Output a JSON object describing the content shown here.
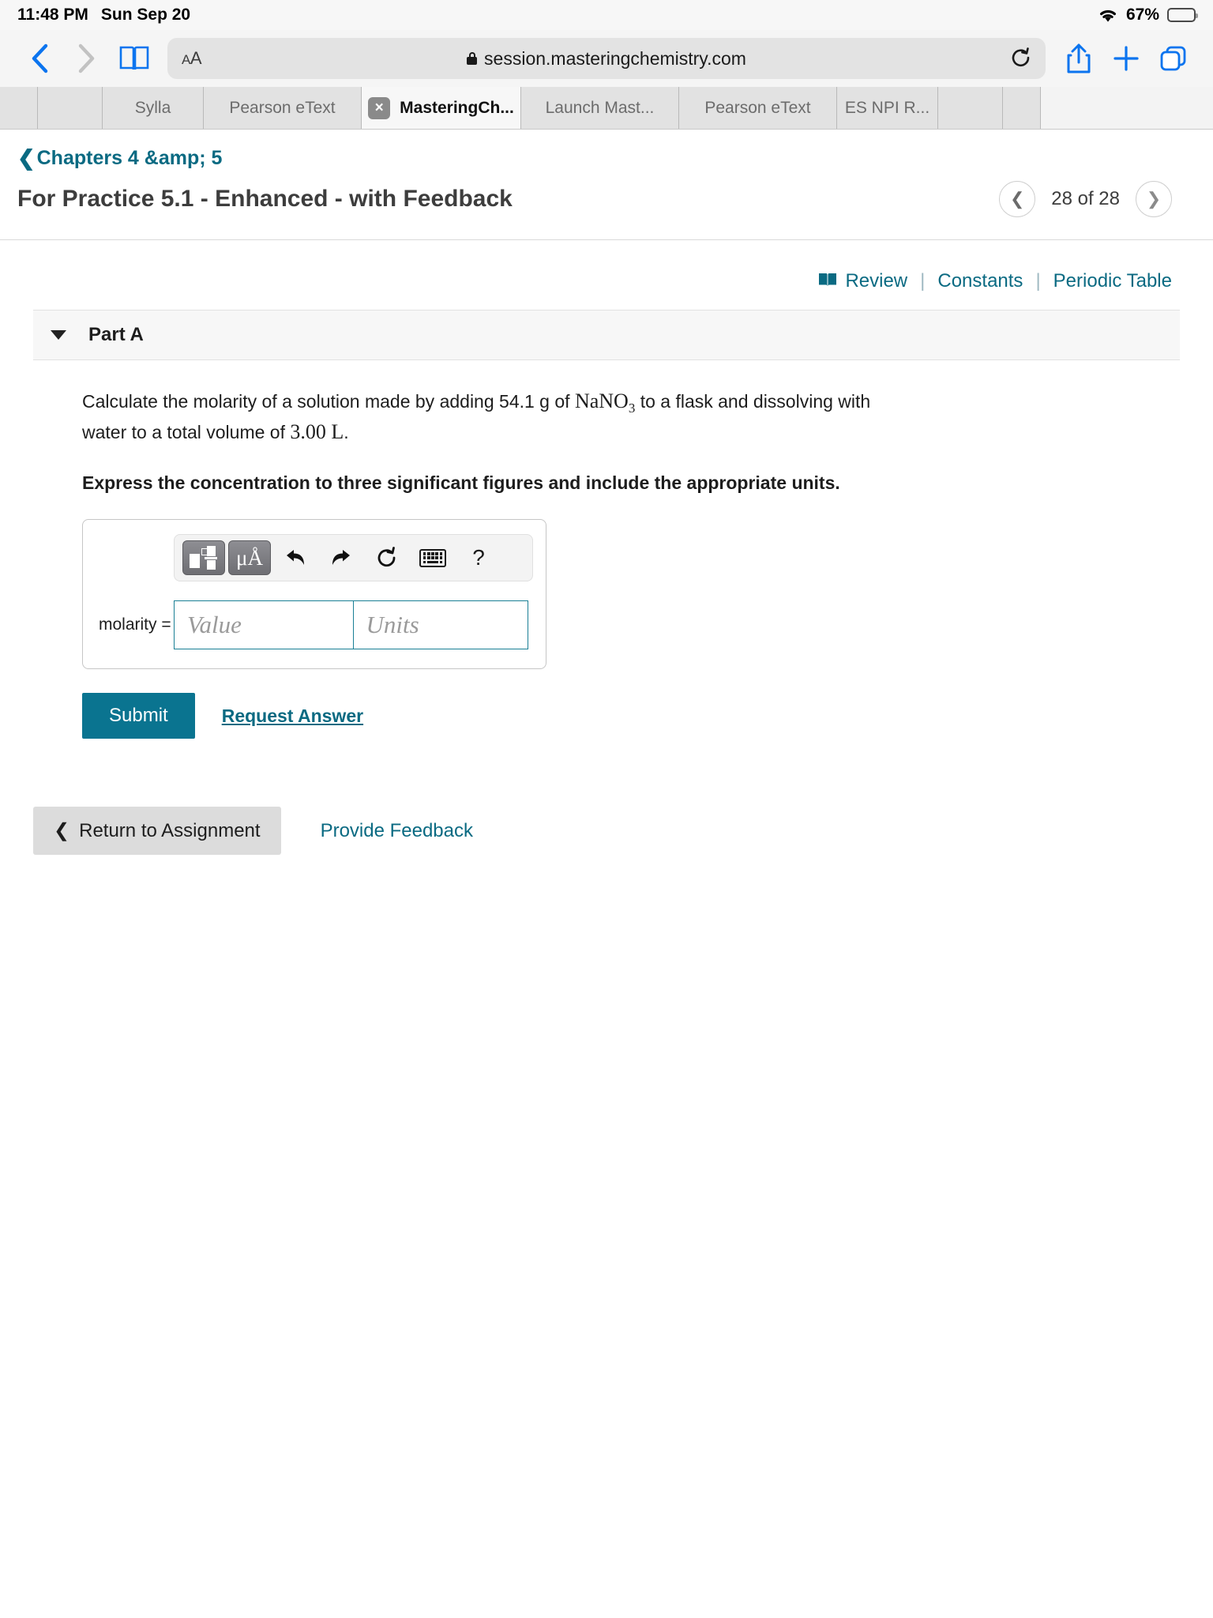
{
  "statusbar": {
    "time": "11:48 PM",
    "date": "Sun Sep 20",
    "battery_percent": "67%",
    "wifi_icon": "wifi-icon",
    "battery_icon": "battery-icon"
  },
  "browser": {
    "back_icon": "chevron-left-icon",
    "forward_icon": "chevron-right-icon",
    "bookmarks_icon": "book-icon",
    "text_size_label": "AA",
    "lock_icon": "lock-icon",
    "url": "session.masteringchemistry.com",
    "reload_icon": "reload-icon",
    "share_icon": "share-icon",
    "new_tab_icon": "plus-icon",
    "tabs_overview_icon": "tabs-icon",
    "tabs": [
      {
        "label": "",
        "active": false,
        "width": "tab-w-xs",
        "closable": false
      },
      {
        "label": "",
        "active": false,
        "width": "tab-w-sm",
        "closable": false
      },
      {
        "label": "Sylla",
        "active": false,
        "width": "tab-w-md",
        "closable": false
      },
      {
        "label": "Pearson eText",
        "active": false,
        "width": "tab-w-lg",
        "closable": false
      },
      {
        "label": "MasteringCh...",
        "active": true,
        "width": "tab-w-xl",
        "closable": true
      },
      {
        "label": "Launch Mast...",
        "active": false,
        "width": "tab-w-lg",
        "closable": false
      },
      {
        "label": "Pearson eText",
        "active": false,
        "width": "tab-w-lg",
        "closable": false
      },
      {
        "label": "ES NPI R...",
        "active": false,
        "width": "tab-w-md",
        "closable": false
      },
      {
        "label": "",
        "active": false,
        "width": "tab-w-sm",
        "closable": false
      },
      {
        "label": "",
        "active": false,
        "width": "tab-w-xs",
        "closable": false
      }
    ]
  },
  "page": {
    "breadcrumb": "Chapters 4 &amp; 5",
    "breadcrumb_back_icon": "chevron-left-icon",
    "title": "For Practice 5.1 - Enhanced - with Feedback",
    "pager": {
      "prev_icon": "chevron-left-icon",
      "next_icon": "chevron-right-icon",
      "label": "28 of 28"
    },
    "resources": {
      "review": "Review",
      "review_icon": "open-book-icon",
      "separator": "|",
      "constants": "Constants",
      "periodic_table": "Periodic Table"
    }
  },
  "part": {
    "collapse_icon": "caret-down-icon",
    "label": "Part A",
    "question_prefix": "Calculate the molarity of a solution made by adding 54.1 g of ",
    "question_formula": "NaNO",
    "question_formula_sub": "3",
    "question_middle": " to a flask and dissolving with water to a total volume of ",
    "question_amount": "3.00",
    "question_unit": "L",
    "question_suffix": ".",
    "instruction": "Express the concentration to three significant figures and include the appropriate units."
  },
  "answer": {
    "toolbar": {
      "template_icon": "math-template-icon",
      "units_icon": "micro-angstrom-icon",
      "units_label": "μÅ",
      "undo_icon": "undo-icon",
      "redo_icon": "redo-icon",
      "reset_icon": "reset-icon",
      "keyboard_icon": "keyboard-icon",
      "help_icon": "help-icon",
      "help_label": "?"
    },
    "label": "molarity =",
    "value_placeholder": "Value",
    "units_placeholder": "Units",
    "value": "",
    "units": "",
    "submit_label": "Submit",
    "request_answer_label": "Request Answer"
  },
  "footer": {
    "return_icon": "chevron-left-icon",
    "return_label": "Return to Assignment",
    "feedback_label": "Provide Feedback"
  },
  "colors": {
    "brand_teal": "#0a7490",
    "link_teal": "#0a6a82",
    "ios_blue": "#0b74ef"
  }
}
